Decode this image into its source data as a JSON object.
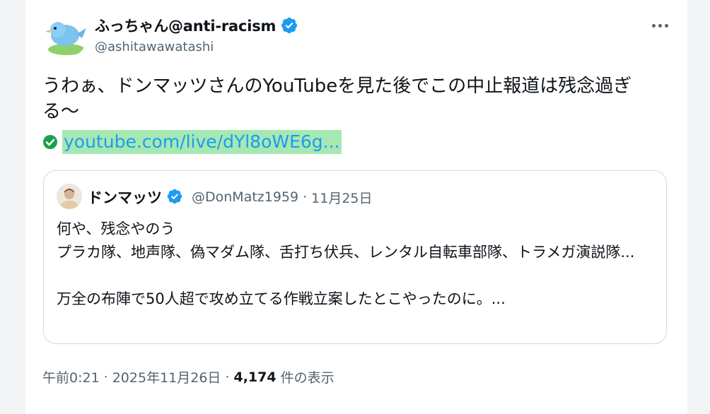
{
  "tweet": {
    "display_name": "ふっちゃん@anti-racism",
    "handle": "@ashitawawatashi",
    "text": "うわぁ、ドンマッツさんのYouTubeを見た後でこの中止報道は残念過ぎる〜",
    "link": "youtube.com/live/dYl8oWE6g..."
  },
  "quote": {
    "display_name": "ドンマッツ",
    "handle": "@DonMatz1959",
    "separator": "·",
    "date": "11月25日",
    "body": "何や、残念やのう\nプラカ隊、地声隊、偽マダム隊、舌打ち伏兵、レンタル自転車部隊、トラメガ演説隊...\n\n万全の布陣で50人超で攻め立てる作戦立案したとこやったのに。..."
  },
  "footer": {
    "time": "午前0:21",
    "sep1": "·",
    "date": "2025年11月26日",
    "sep2": "·",
    "views_count": "4,174",
    "views_label": "件の表示"
  },
  "colors": {
    "verified_blue": "#1d9bf0",
    "link_blue": "#1d9bf0",
    "link_highlight": "#a6e8b2",
    "check_green": "#17a34a",
    "secondary_text": "#536471"
  },
  "icons": {
    "verified": "verified-badge-icon",
    "more": "more-horizontal-icon",
    "link_check": "check-circle-icon"
  }
}
